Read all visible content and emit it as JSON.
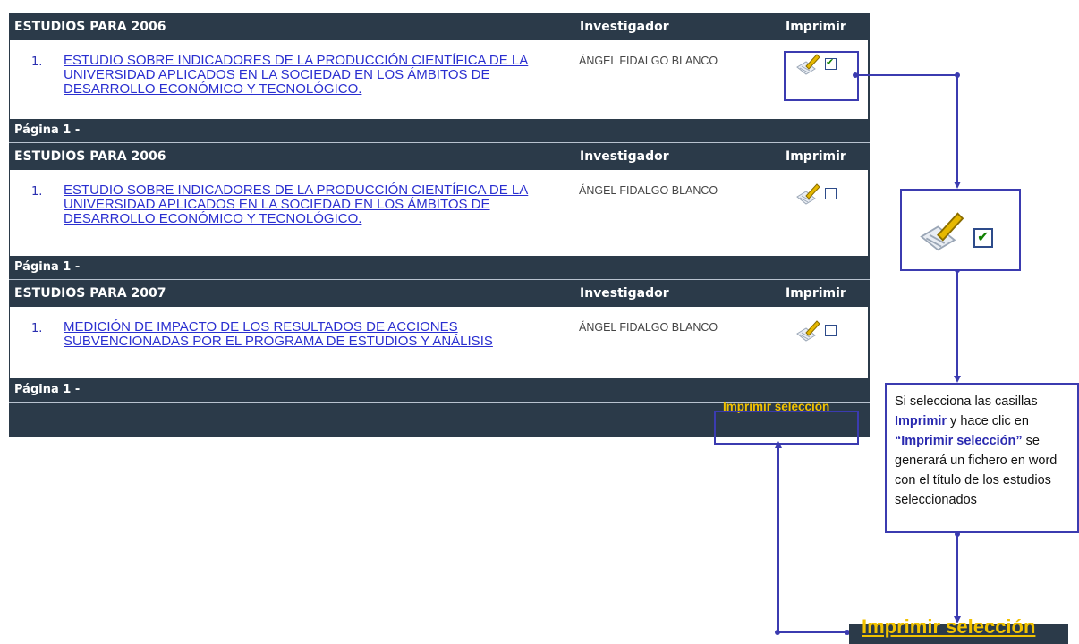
{
  "sections": [
    {
      "header": {
        "title": "ESTUDIOS PARA 2006",
        "investigador": "Investigador",
        "imprimir": "Imprimir"
      },
      "item": {
        "number": "1.",
        "title": "ESTUDIO SOBRE INDICADORES DE LA PRODUCCIÓN CIENTÍFICA DE LA UNIVERSIDAD APLICADOS EN LA SOCIEDAD EN LOS ÁMBITOS DE DESARROLLO ECONÓMICO Y TECNOLÓGICO.",
        "investigador": "ÁNGEL FIDALGO BLANCO",
        "checked": true
      },
      "page_label": "Página 1 -"
    },
    {
      "header": {
        "title": "ESTUDIOS PARA 2006",
        "investigador": "Investigador",
        "imprimir": "Imprimir"
      },
      "item": {
        "number": "1.",
        "title": "ESTUDIO SOBRE INDICADORES DE LA PRODUCCIÓN CIENTÍFICA DE LA UNIVERSIDAD APLICADOS EN LA SOCIEDAD EN LOS ÁMBITOS DE DESARROLLO ECONÓMICO Y TECNOLÓGICO.",
        "investigador": "ÁNGEL FIDALGO BLANCO",
        "checked": false
      },
      "page_label": "Página 1 -"
    },
    {
      "header": {
        "title": "ESTUDIOS PARA 2007",
        "investigador": "Investigador",
        "imprimir": "Imprimir"
      },
      "item": {
        "number": "1.",
        "title": "MEDICIÓN DE IMPACTO DE LOS RESULTADOS DE ACCIONES SUBVENCIONADAS POR EL PROGRAMA DE ESTUDIOS Y ANÁLISIS",
        "investigador": "ÁNGEL FIDALGO BLANCO",
        "checked": false
      },
      "page_label": "Página 1 -"
    }
  ],
  "footer": {
    "print_selection": "Imprimir selección"
  },
  "note": {
    "part1": "Si selecciona las casillas ",
    "bold1": "Imprimir",
    "part2": " y hace clic en ",
    "bold2": "“Imprimir selección”",
    "part3": " se generará un fichero en word con el título de los estudios seleccionados"
  },
  "big_button": {
    "label": "Imprimir selección"
  },
  "colors": {
    "header_bg": "#2b3a49",
    "link": "#2a2fd0",
    "accent": "#f2c200",
    "annotation": "#3b3bb0"
  }
}
